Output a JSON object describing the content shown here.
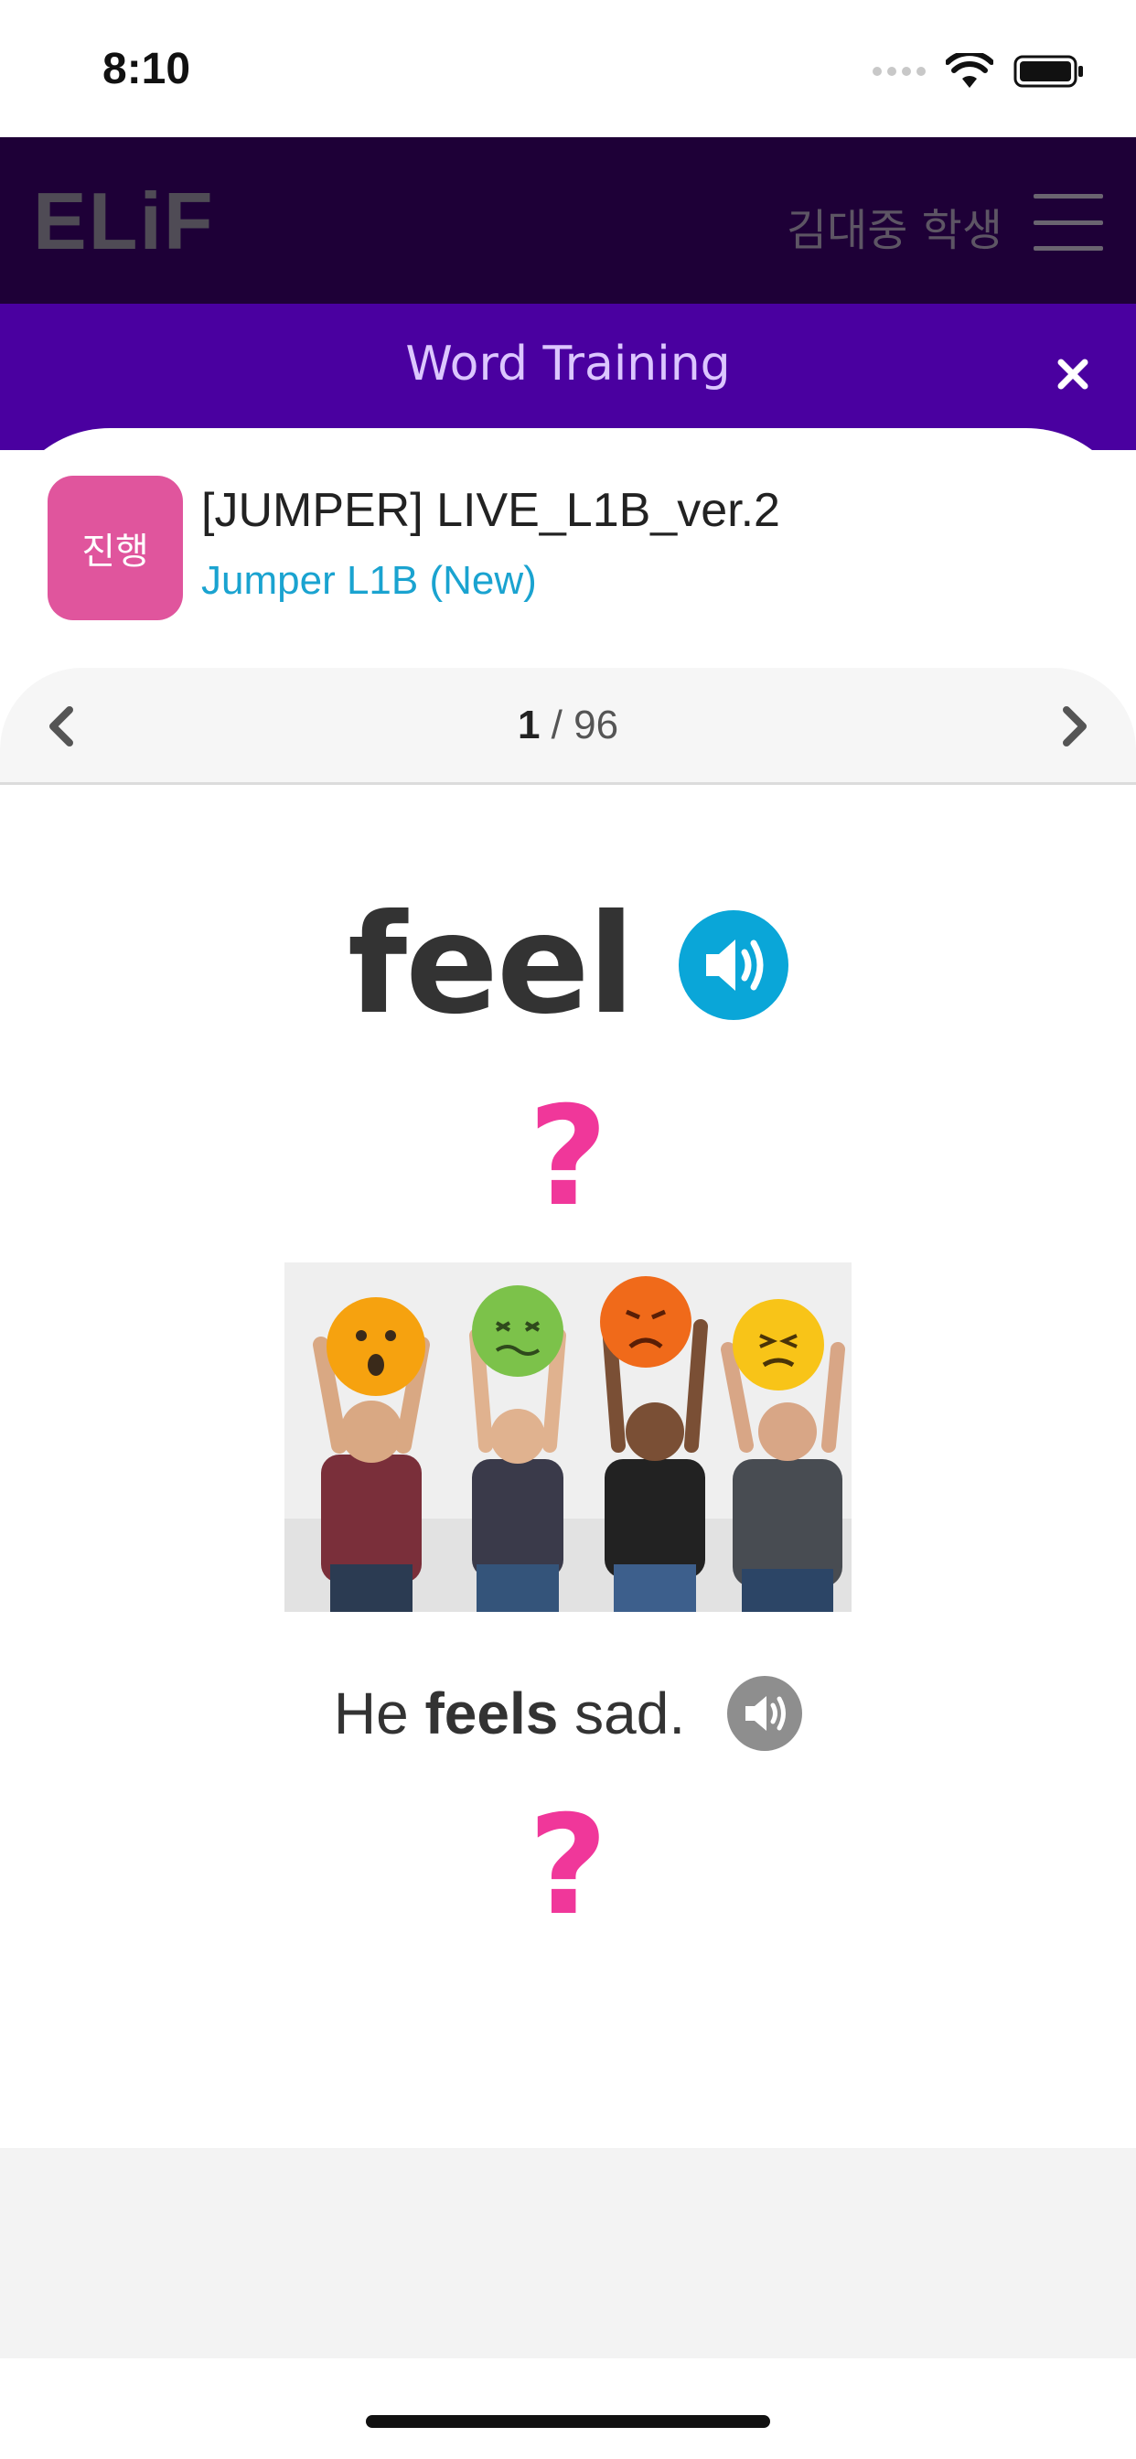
{
  "status_bar": {
    "time": "8:10",
    "icons": [
      "signal-dots-icon",
      "wifi-icon",
      "battery-icon"
    ]
  },
  "header": {
    "logo_text": "ELiF",
    "user_name": "김대중 학생",
    "menu_icon": "hamburger-icon"
  },
  "banner": {
    "title": "Word Training",
    "close_icon": "close-icon"
  },
  "course": {
    "badge": "진행",
    "title": "[JUMPER] LIVE_L1B_ver.2",
    "subtitle": "Jumper L1B (New)"
  },
  "pager": {
    "current": "1",
    "separator": " / ",
    "total": "96",
    "prev_icon": "chevron-left-icon",
    "next_icon": "chevron-right-icon"
  },
  "card": {
    "word": "feel",
    "word_audio_icon": "speaker-icon",
    "question_mark_1": "?",
    "image_alt": "people holding emoji faces",
    "sentence_before": "He ",
    "sentence_bold": "feels",
    "sentence_after": " sad.",
    "sentence_audio_icon": "speaker-icon",
    "question_mark_2": "?"
  },
  "colors": {
    "header_bg": "#1e0037",
    "banner_bg": "#4a00a0",
    "badge_bg": "#e0559d",
    "accent_blue": "#1aa3d0",
    "question_pink": "#f0379a"
  }
}
